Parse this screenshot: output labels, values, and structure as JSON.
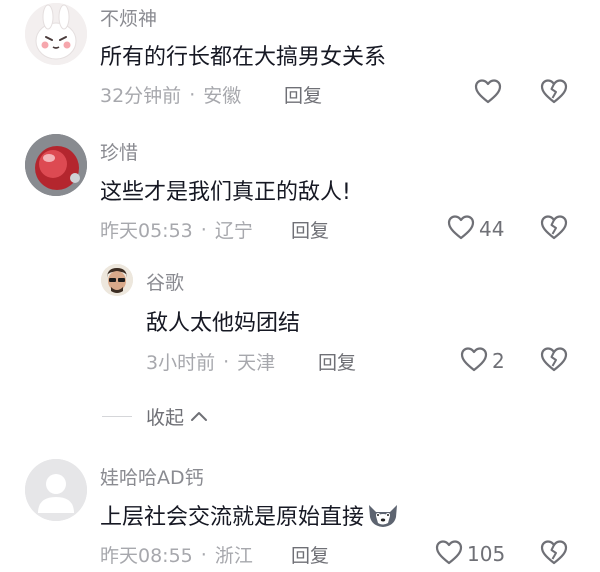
{
  "comments": [
    {
      "username": "不烦神",
      "text": "所有的行长都在大搞男女关系",
      "time": "32分钟前",
      "location": "安徽",
      "reply_label": "回复",
      "likes": ""
    },
    {
      "username": "珍惜",
      "text": "这些才是我们真正的敌人!",
      "time": "昨天05:53",
      "location": "辽宁",
      "reply_label": "回复",
      "likes": "44",
      "replies": [
        {
          "username": "谷歌",
          "text": "敌人太他妈团结",
          "time": "3小时前",
          "location": "天津",
          "reply_label": "回复",
          "likes": "2"
        }
      ],
      "collapse_label": "收起"
    },
    {
      "username": "娃哈哈AD钙",
      "text": "上层社会交流就是原始直接",
      "emoji": "wolf-emoji",
      "time": "昨天08:55",
      "location": "浙江",
      "reply_label": "回复",
      "likes": "105"
    }
  ],
  "separator": "·",
  "icons": {
    "like": "heart-outline-icon",
    "dislike": "broken-heart-icon",
    "collapse": "chevron-up-icon"
  },
  "colors": {
    "text_primary": "#161823",
    "text_secondary": "#8a8b91",
    "icon": "#6f7076"
  }
}
